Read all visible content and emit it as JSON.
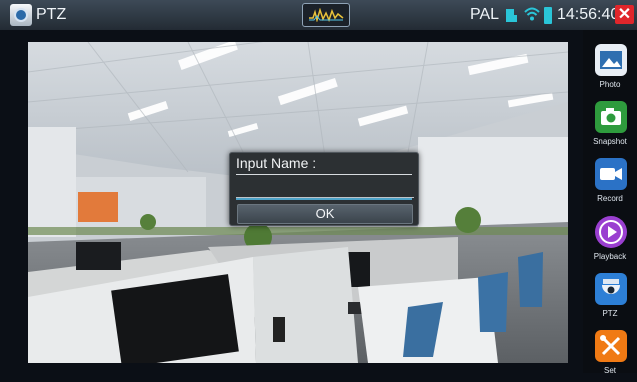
{
  "header": {
    "title": "PTZ",
    "video_format": "PAL",
    "time": "14:56:40"
  },
  "sidebar": {
    "items": [
      {
        "label": "Photo",
        "icon": "photo-icon",
        "color": "#e8eef5"
      },
      {
        "label": "Snapshot",
        "icon": "camera-icon",
        "color": "#2e9b3d"
      },
      {
        "label": "Record",
        "icon": "video-camera-icon",
        "color": "#2b72c6"
      },
      {
        "label": "Playback",
        "icon": "play-icon",
        "color": "#9a3fd0"
      },
      {
        "label": "PTZ",
        "icon": "dome-camera-icon",
        "color": "#2d7fd6"
      },
      {
        "label": "Set",
        "icon": "tools-icon",
        "color": "#f07a14"
      }
    ]
  },
  "dialog": {
    "label": "Input Name :",
    "input_value": "",
    "ok_label": "OK"
  },
  "colors": {
    "topbar": "#2f3944",
    "close": "#e0262b",
    "dialog_bg": "#2c3033"
  }
}
